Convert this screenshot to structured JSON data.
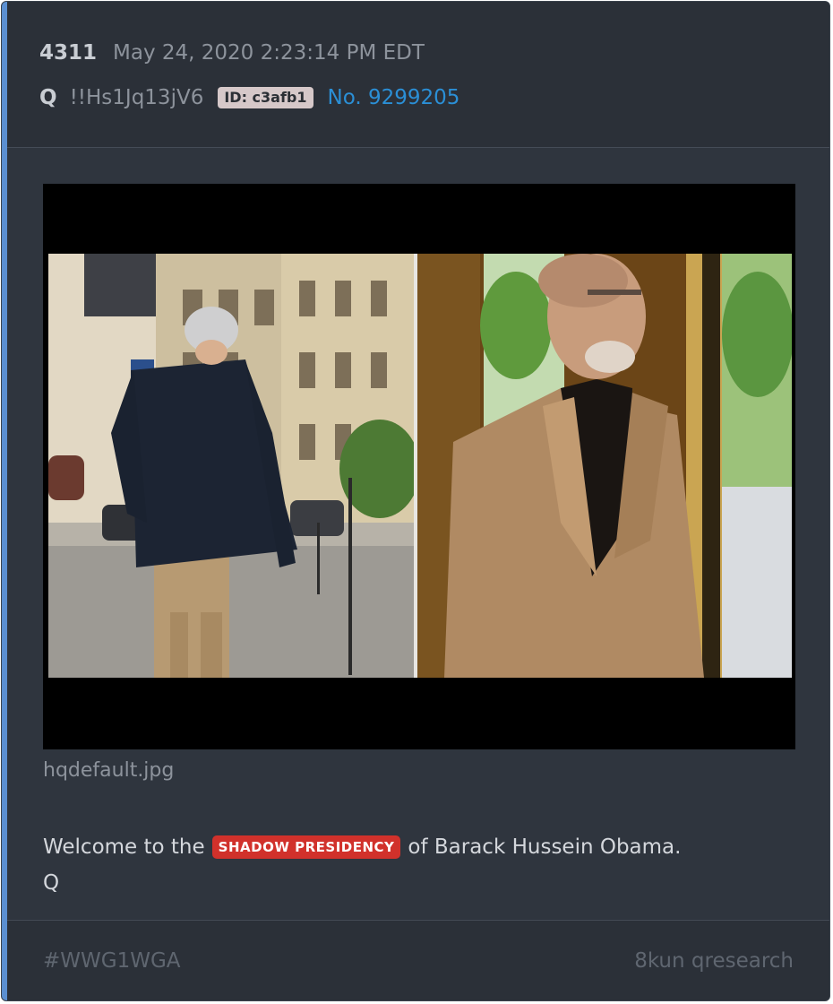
{
  "post": {
    "number": "4311",
    "date": "May 24, 2020 2:23:14 PM EDT",
    "author": "Q",
    "tripcode": "!!Hs1Jq13jV6",
    "id_badge": "ID: c3afb1",
    "post_no": "No. 9299205"
  },
  "attachment": {
    "filename": "hqdefault.jpg"
  },
  "message": {
    "prefix": "Welcome to the",
    "highlight": "SHADOW PRESIDENCY",
    "suffix": "of Barack Hussein Obama.",
    "signature": "Q"
  },
  "footer": {
    "hashtag": "#WWG1WGA",
    "source": "8kun qresearch"
  },
  "colors": {
    "background": "#2f353e",
    "accent": "#5b8fd1",
    "link": "#2b8fd6",
    "highlight": "#d1312b"
  }
}
